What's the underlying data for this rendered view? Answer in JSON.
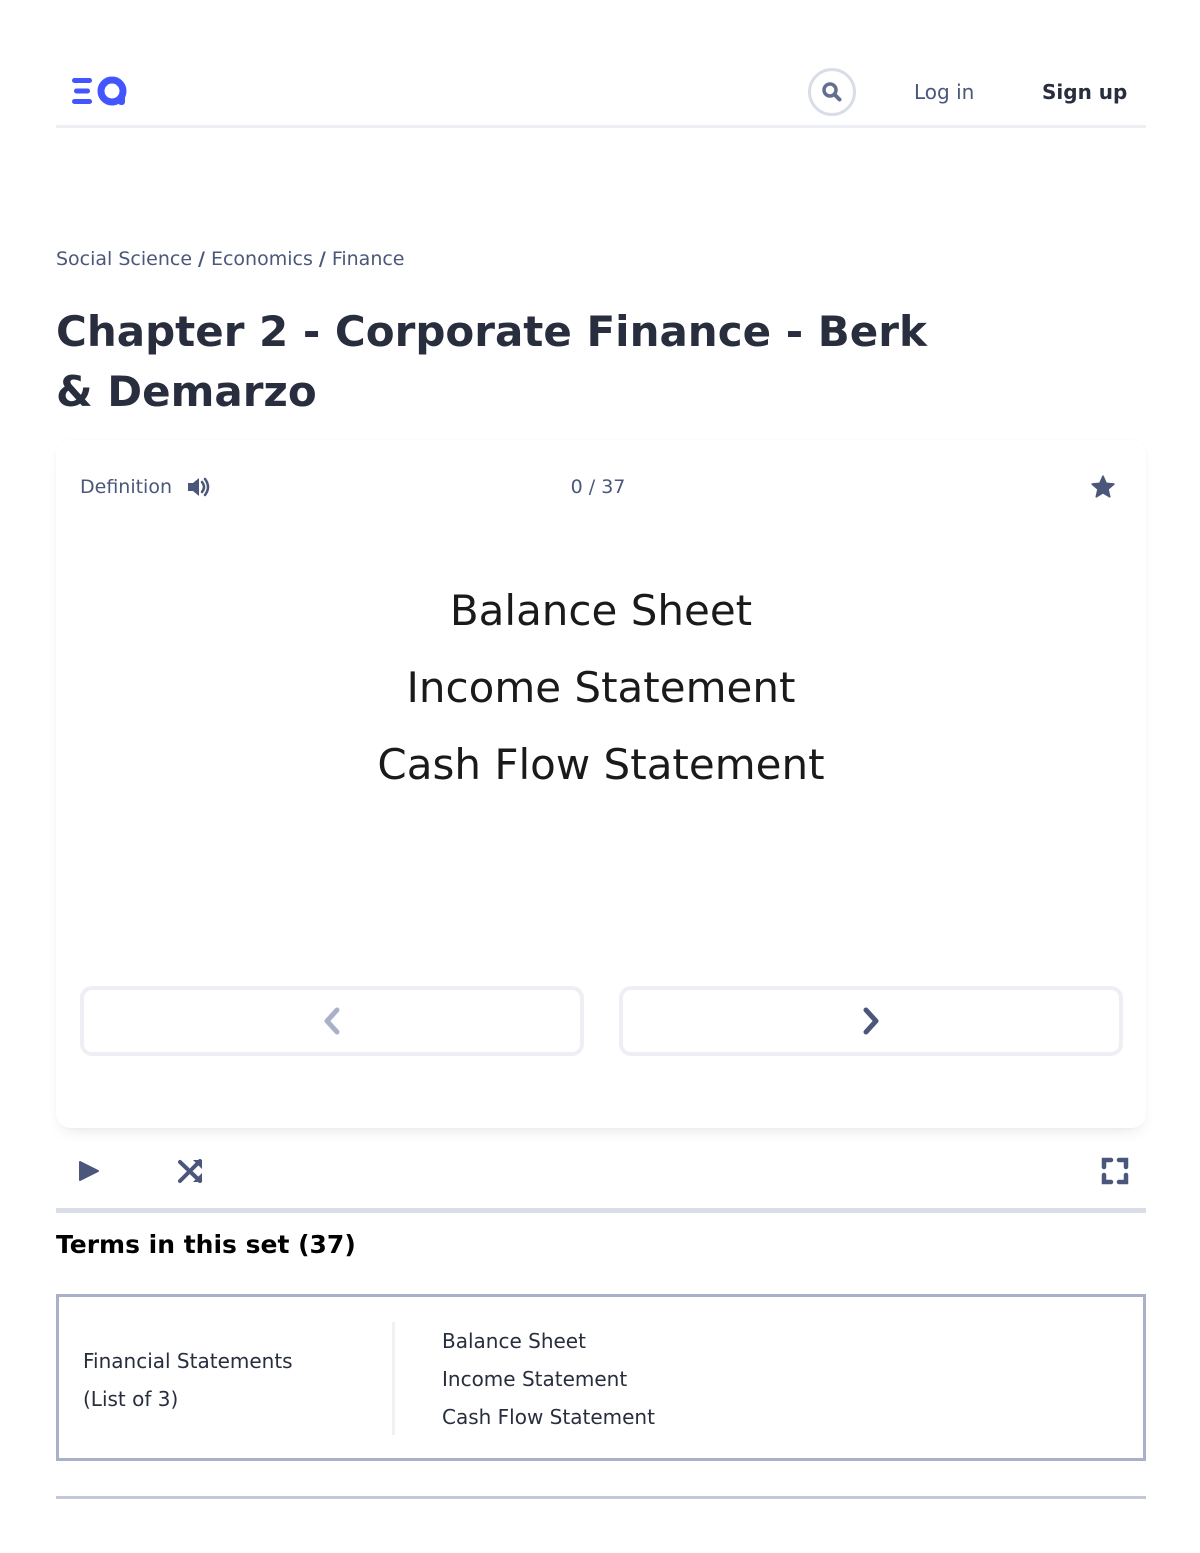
{
  "header": {
    "logo_alt": "Quizlet logo",
    "login_label": "Log in",
    "signup_label": "Sign up"
  },
  "breadcrumb": [
    {
      "label": "Social Science"
    },
    {
      "label": "Economics"
    },
    {
      "label": "Finance"
    }
  ],
  "breadcrumb_sep": "/",
  "page_title": "Chapter 2 - Corporate Finance - Berk & Demarzo",
  "flashcard": {
    "side_label": "Definition",
    "counter": "0 / 37",
    "lines": [
      "Balance Sheet",
      "Income Statement",
      "Cash Flow Statement"
    ]
  },
  "terms": {
    "heading": "Terms in this set (37)",
    "items": [
      {
        "term_lines": [
          "Financial Statements",
          "(List of 3)"
        ],
        "definition_lines": [
          "Balance Sheet",
          "Income Statement",
          "Cash Flow Statement"
        ]
      }
    ]
  },
  "colors": {
    "brand": "#4255ff",
    "text_primary": "#282e3e",
    "text_secondary": "#4b577a",
    "border": "#edeff4",
    "disabled_icon": "#a8b1c9"
  }
}
